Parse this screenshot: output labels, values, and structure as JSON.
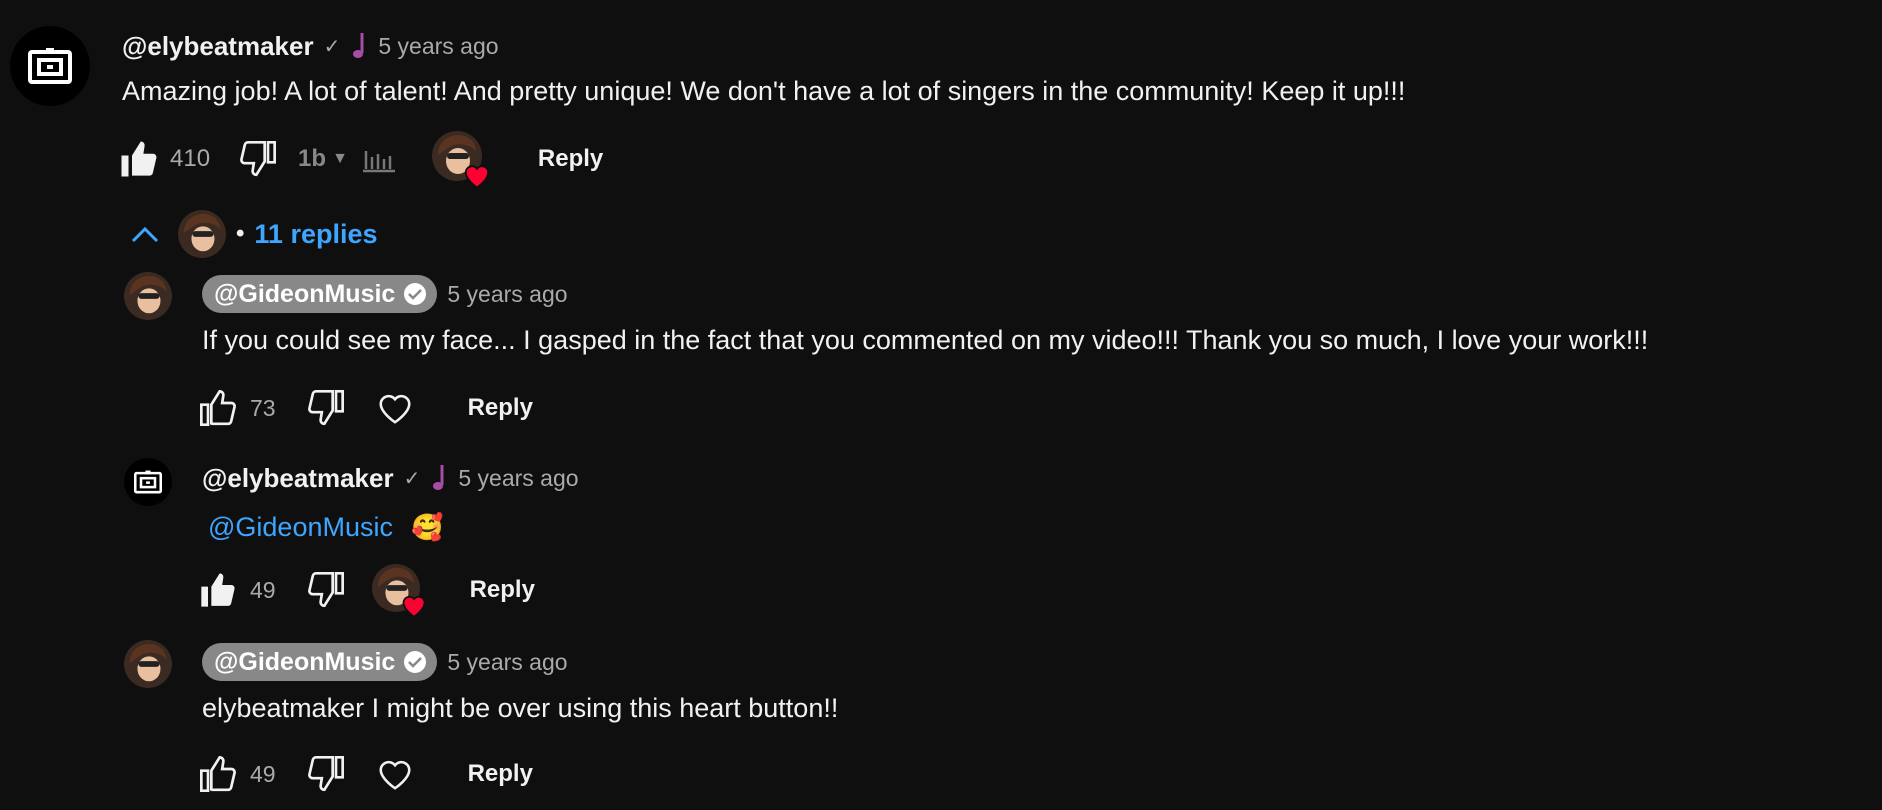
{
  "top_comment": {
    "author": "@elybeatmaker",
    "time": "5 years ago",
    "text": "Amazing job! A lot of talent! And pretty unique! We don't have a lot of singers in the community! Keep it up!!!",
    "likes": "410",
    "reply_label": "Reply",
    "badge_icon": "music-note-icon",
    "hearted": true
  },
  "replies_toggle": {
    "label": "11 replies",
    "separator": "•",
    "expanded": true
  },
  "replies": [
    {
      "author": "@GideonMusic",
      "time": "5 years ago",
      "text": "If you could see my face... I gasped in the fact that you commented on my video!!! Thank you so much, I love your work!!!",
      "likes": "73",
      "reply_label": "Reply",
      "author_is_creator": true,
      "hearted": false
    },
    {
      "author": "@elybeatmaker",
      "time": "5 years ago",
      "mention": "@GideonMusic",
      "emoji": "🥰",
      "likes": "49",
      "reply_label": "Reply",
      "hearted": true
    },
    {
      "author": "@GideonMusic",
      "time": "5 years ago",
      "text": "elybeatmaker I might be over using this heart button!!",
      "likes": "49",
      "reply_label": "Reply",
      "author_is_creator": true,
      "hearted": false
    }
  ],
  "colors": {
    "background": "#0f0f0f",
    "text": "#f1f1f1",
    "secondary": "#aaaaaa",
    "link": "#3ea6ff",
    "heart": "#ff0033",
    "creator_chip": "#888888",
    "badge": "#a64ca6"
  }
}
